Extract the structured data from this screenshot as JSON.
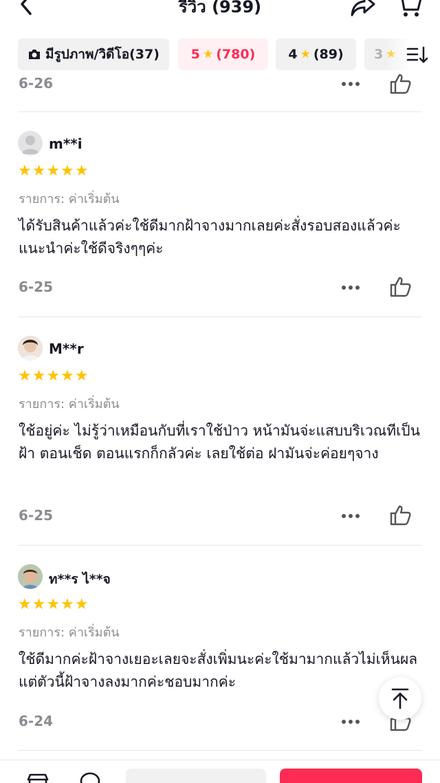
{
  "header": {
    "title": "รีวิว (939)"
  },
  "filters": [
    {
      "label": "มีรูปภาพ/วิดีโอ(37)",
      "icon": "camera-icon"
    },
    {
      "label": "5 ★ (780)",
      "prefix": "5",
      "count": "(780)"
    },
    {
      "label": "4 ★ (89)",
      "prefix": "4",
      "count": "(89)"
    },
    {
      "label": "3",
      "prefix": "3"
    }
  ],
  "top_partial": {
    "date": "6-26"
  },
  "reviews": [
    {
      "username": "m**i",
      "rating": 5,
      "variant": "รายการ: ค่าเริ่มต้น",
      "text": "ได้รับสินค้าแล้วค่ะใช้ดีมากฝ้าจางมากเลยค่ะสั่งรอบสองแล้วค่ะแนะนำค่ะใช้ดีจริงๆๆค่ะ",
      "date": "6-25"
    },
    {
      "username": "M**r",
      "rating": 5,
      "variant": "รายการ: ค่าเริ่มต้น",
      "text": "ใช้อยู่ค่ะ ไม่รู้ว่าเหมือนกับที่เราใช้ป่าว หน้ามันจ่ะแสบบริเวณทีเป็นฝ้า ตอนเช็ด ตอนแรกก็กลัวค่ะ เลยใช้ต่อ ฝามันจ่ะค่อยๆจาง",
      "date": "6-25"
    },
    {
      "username": "ท**ร ไ**จ",
      "rating": 5,
      "variant": "รายการ: ค่าเริ่มต้น",
      "text": "ใช้ดีมากค่ะฝ้าจางเยอะเลยจะสั่งเพิ่มนะค่ะใช้มามากแล้วไม่เห็นผลแต่ตัวนี้ฝ้าจางลงมากค่ะชอบมากค่ะ",
      "date": "6-24"
    }
  ],
  "stars_text": "★★★★★",
  "colors": {
    "accent": "#fe2c55",
    "star": "#ffc300",
    "muted": "#8a8b91"
  }
}
